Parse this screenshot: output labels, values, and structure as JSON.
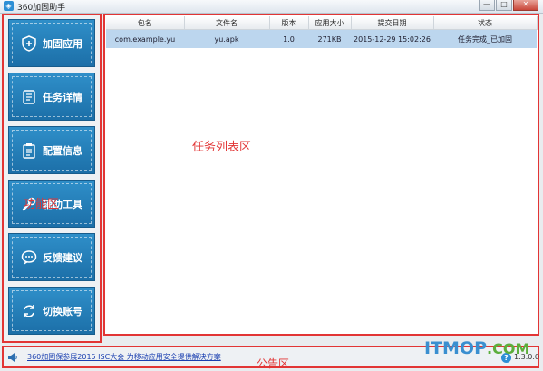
{
  "window": {
    "title": "360加固助手",
    "minimize": "—",
    "restore": "□",
    "close": "✕"
  },
  "menu": {
    "items": [
      {
        "label": "加固应用",
        "icon": "shield-plus-icon"
      },
      {
        "label": "任务详情",
        "icon": "scroll-icon"
      },
      {
        "label": "配置信息",
        "icon": "clipboard-icon"
      },
      {
        "label": "辅助工具",
        "icon": "wrench-icon"
      },
      {
        "label": "反馈建议",
        "icon": "chat-bubble-icon"
      },
      {
        "label": "切换账号",
        "icon": "switch-account-icon"
      }
    ],
    "region_label": "功能区"
  },
  "tasks": {
    "columns": [
      "包名",
      "文件名",
      "版本",
      "应用大小",
      "提交日期",
      "状态"
    ],
    "rows": [
      [
        "com.example.yu",
        "yu.apk",
        "1.0",
        "271KB",
        "2015-12-29 15:02:26",
        "任务完成_已加固"
      ]
    ],
    "region_label": "任务列表区"
  },
  "notice": {
    "link_text": "360加固保参展2015 ISC大会 为移动应用安全提供解决方案",
    "region_label": "公告区",
    "help": "?",
    "version": "1.3.0.0"
  },
  "watermark": {
    "main": "ITMOP",
    "suffix": ".COM"
  },
  "colors": {
    "accent": "#1f76b0",
    "annotation": "#e23535",
    "row_selected": "#bcd6ee"
  }
}
